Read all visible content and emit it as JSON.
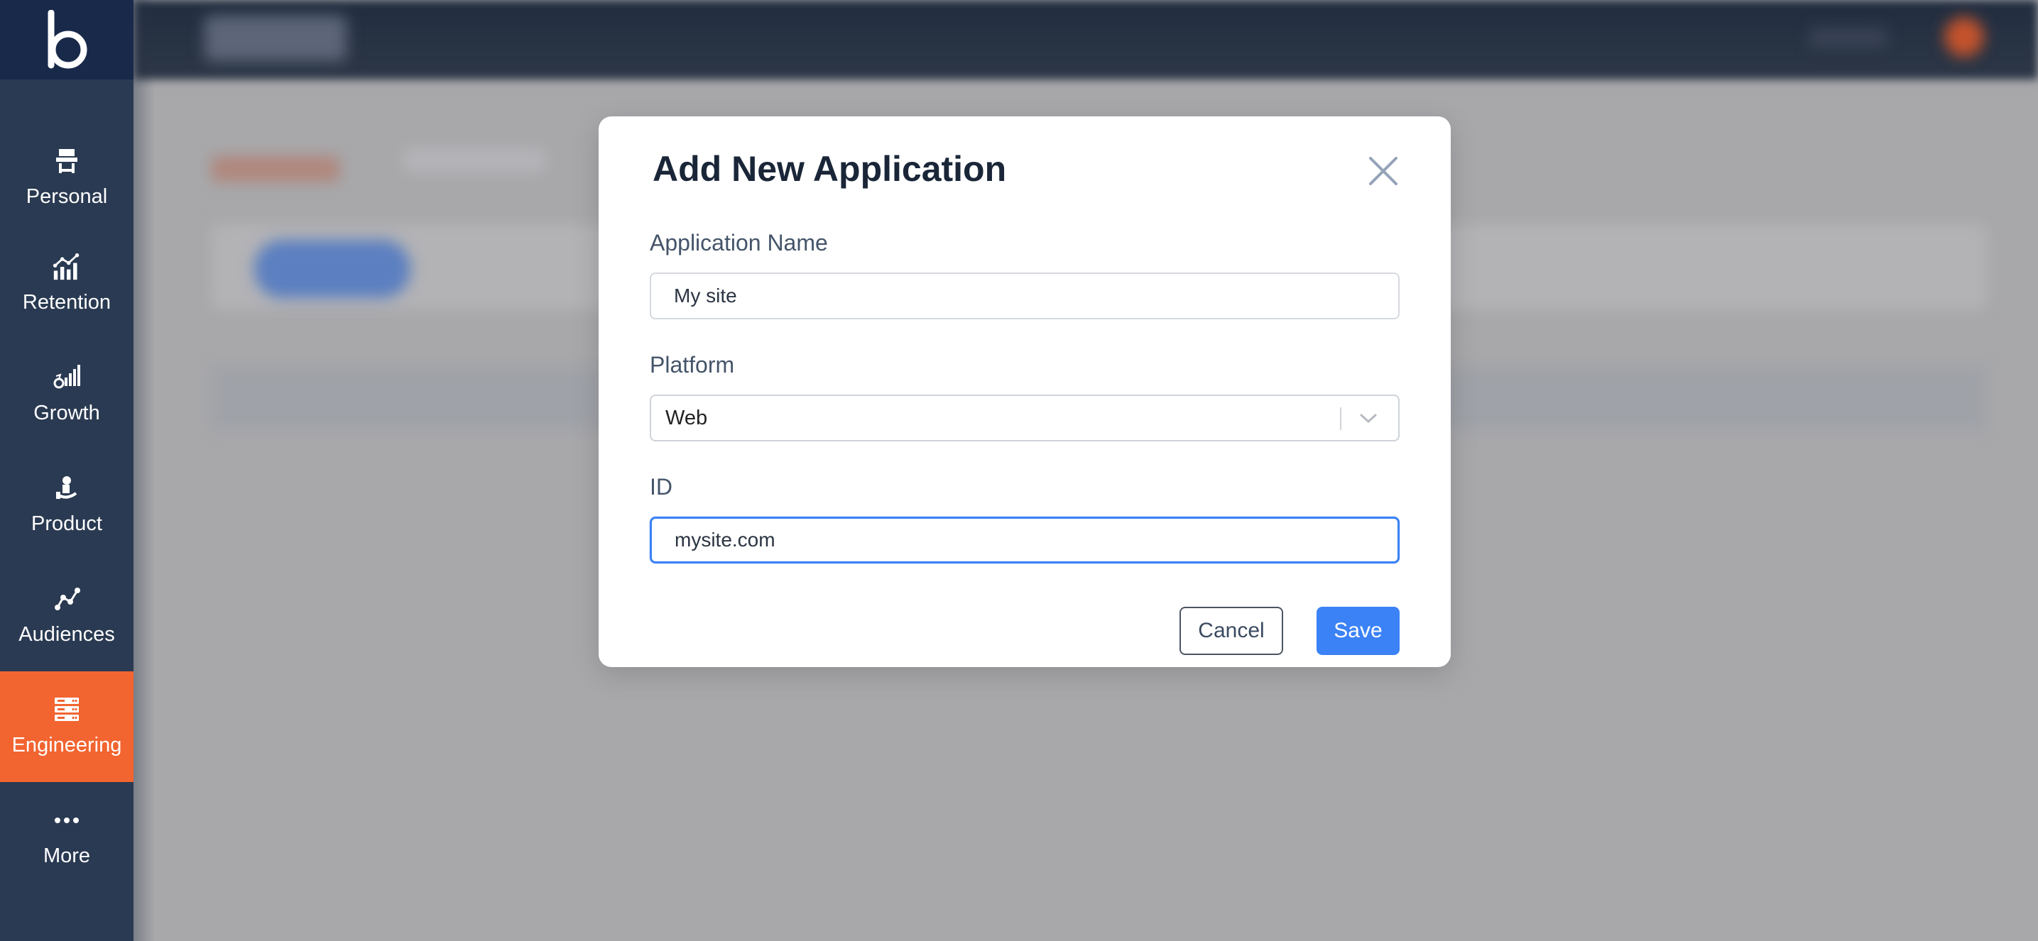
{
  "app": {
    "logo_letter": "b"
  },
  "sidebar": {
    "items": [
      {
        "label": "Personal",
        "icon": "personal-icon",
        "active": false
      },
      {
        "label": "Retention",
        "icon": "retention-chart-icon",
        "active": false
      },
      {
        "label": "Growth",
        "icon": "growth-icon",
        "active": false
      },
      {
        "label": "Product",
        "icon": "product-icon",
        "active": false
      },
      {
        "label": "Audiences",
        "icon": "audiences-icon",
        "active": false
      },
      {
        "label": "Engineering",
        "icon": "engineering-server-icon",
        "active": true
      },
      {
        "label": "More",
        "icon": "more-dots-icon",
        "active": false
      }
    ],
    "colors": {
      "background": "#2a3a52",
      "logo_background": "#19294a",
      "active": "#f26430"
    }
  },
  "modal": {
    "title": "Add New Application",
    "close_icon": "close-icon",
    "fields": {
      "name": {
        "label": "Application Name",
        "value": "My site"
      },
      "platform": {
        "label": "Platform",
        "selected": "Web"
      },
      "id": {
        "label": "ID",
        "value": "mysite.com"
      }
    },
    "buttons": {
      "cancel": "Cancel",
      "save": "Save"
    },
    "colors": {
      "primary": "#3b82f6",
      "title": "#1a2638"
    }
  }
}
